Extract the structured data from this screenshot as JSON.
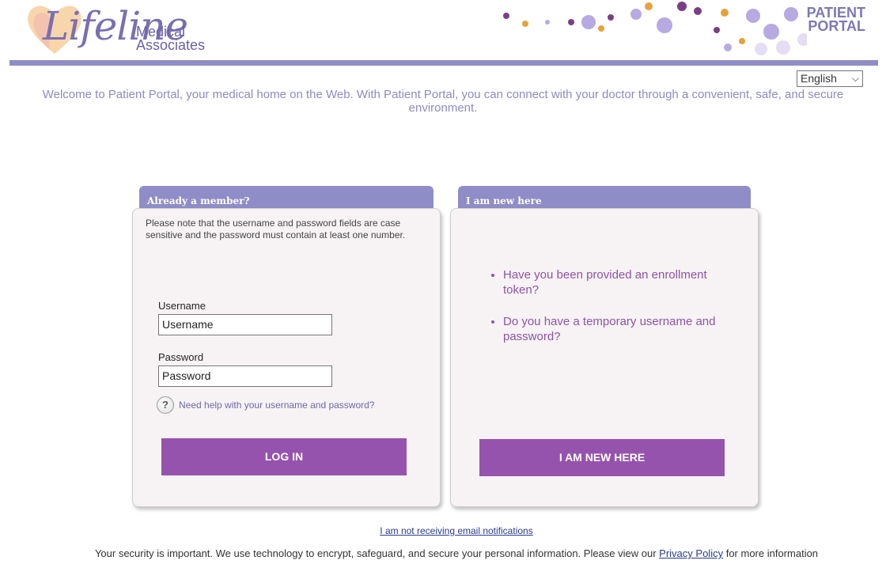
{
  "header": {
    "logo_word": "Lifeline",
    "logo_sub_1": "Medical",
    "logo_sub_2": "Associates",
    "portal_line_1": "PATIENT",
    "portal_line_2": "PORTAL"
  },
  "language": {
    "selected": "English"
  },
  "welcome_text": "Welcome to Patient Portal, your medical home on the Web. With Patient Portal, you can connect with your doctor through a convenient, safe, and secure environment.",
  "member_panel": {
    "tab_label": "Already a member?",
    "note": "Please note that the username and password fields are case sensitive and the password must contain at least one number.",
    "username_label": "Username",
    "username_value": "Username",
    "password_label": "Password",
    "password_value": "Password",
    "help_text": "Need help with your username and password?",
    "login_label": "LOG IN"
  },
  "new_panel": {
    "tab_label": "I am new here",
    "bullets": [
      "Have you been provided an enrollment token?",
      "Do you have a temporary username and password?"
    ],
    "button_label": "I AM NEW HERE"
  },
  "footer": {
    "email_link": "I am not receiving email notifications",
    "security_before": "Your security is important. We use technology to encrypt, safeguard, and secure your personal information. Please view our",
    "privacy_link": "Privacy Policy",
    "security_after": "for more information"
  },
  "colors": {
    "accent_lavender": "#8f8dc7",
    "button_purple": "#9653ad",
    "bullet_purple": "#8f52a9"
  },
  "icons": [
    "help-icon",
    "chevron-down-icon",
    "logo-heart-icon",
    "flowers-decoration"
  ]
}
